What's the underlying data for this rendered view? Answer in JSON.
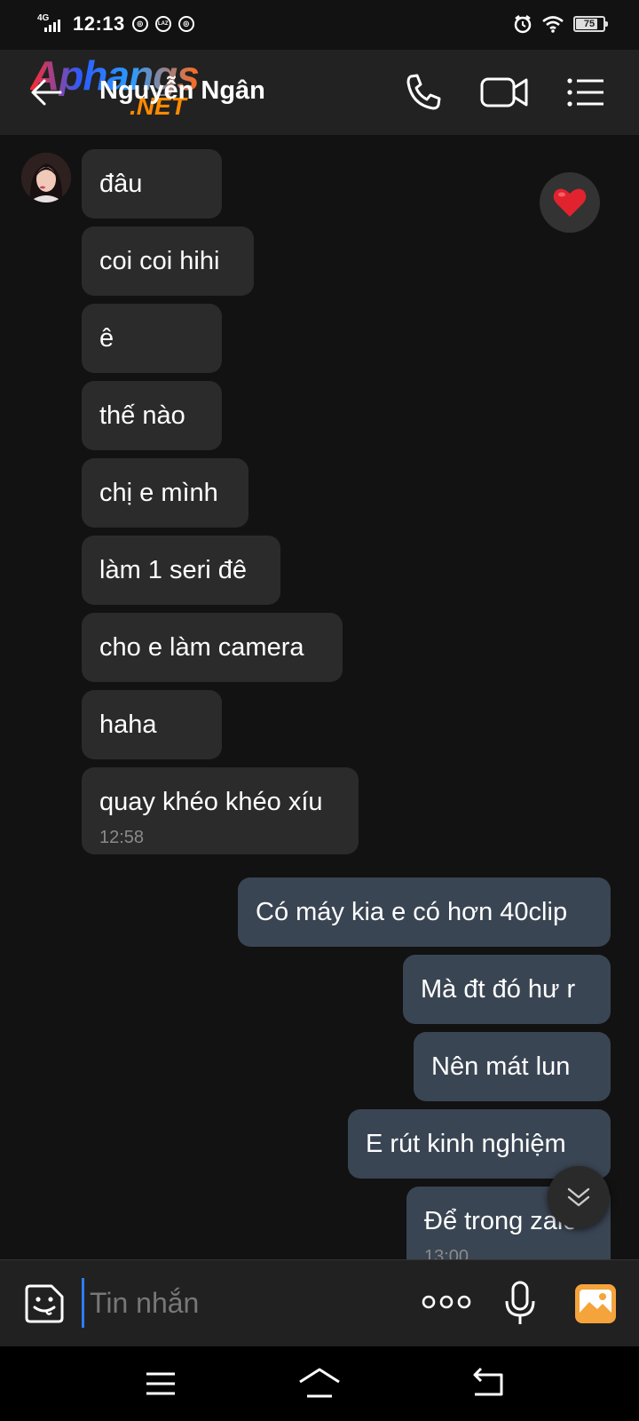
{
  "status_bar": {
    "network": "4G",
    "time": "12:13",
    "app_badge": "LAZ",
    "battery": "75"
  },
  "header": {
    "watermark_main": "Aphangs",
    "watermark_suffix": ".NET",
    "contact_name": "Nguyễn Ngân",
    "icons": [
      "back-arrow-icon",
      "phone-icon",
      "video-call-icon",
      "menu-list-icon"
    ]
  },
  "messages": {
    "incoming": [
      {
        "text": "đâu"
      },
      {
        "text": "coi coi hihi"
      },
      {
        "text": "ê"
      },
      {
        "text": "thế nào"
      },
      {
        "text": "chị e mình"
      },
      {
        "text": "làm 1 seri đê"
      },
      {
        "text": "cho e làm camera"
      },
      {
        "text": "haha"
      },
      {
        "text": "quay khéo khéo xíu",
        "time": "12:58"
      }
    ],
    "outgoing": [
      {
        "text": "Có máy kia e có hơn 40clip"
      },
      {
        "text": "Mà đt đó hư r"
      },
      {
        "text": "Nên mát lun"
      },
      {
        "text": "E rút kinh nghiệm"
      },
      {
        "text": "Để trong zalo",
        "time": "13:00"
      }
    ],
    "reaction": "heart"
  },
  "composer": {
    "placeholder": "Tin nhắn",
    "icons": [
      "sticker-emoji-icon",
      "more-dots-icon",
      "microphone-icon",
      "gallery-icon"
    ]
  },
  "colors": {
    "background": "#121212",
    "incoming_bubble": "#2b2b2b",
    "outgoing_bubble": "#3a4553",
    "cursor": "#2d7cf6",
    "gallery_icon": "#f5a33b"
  }
}
